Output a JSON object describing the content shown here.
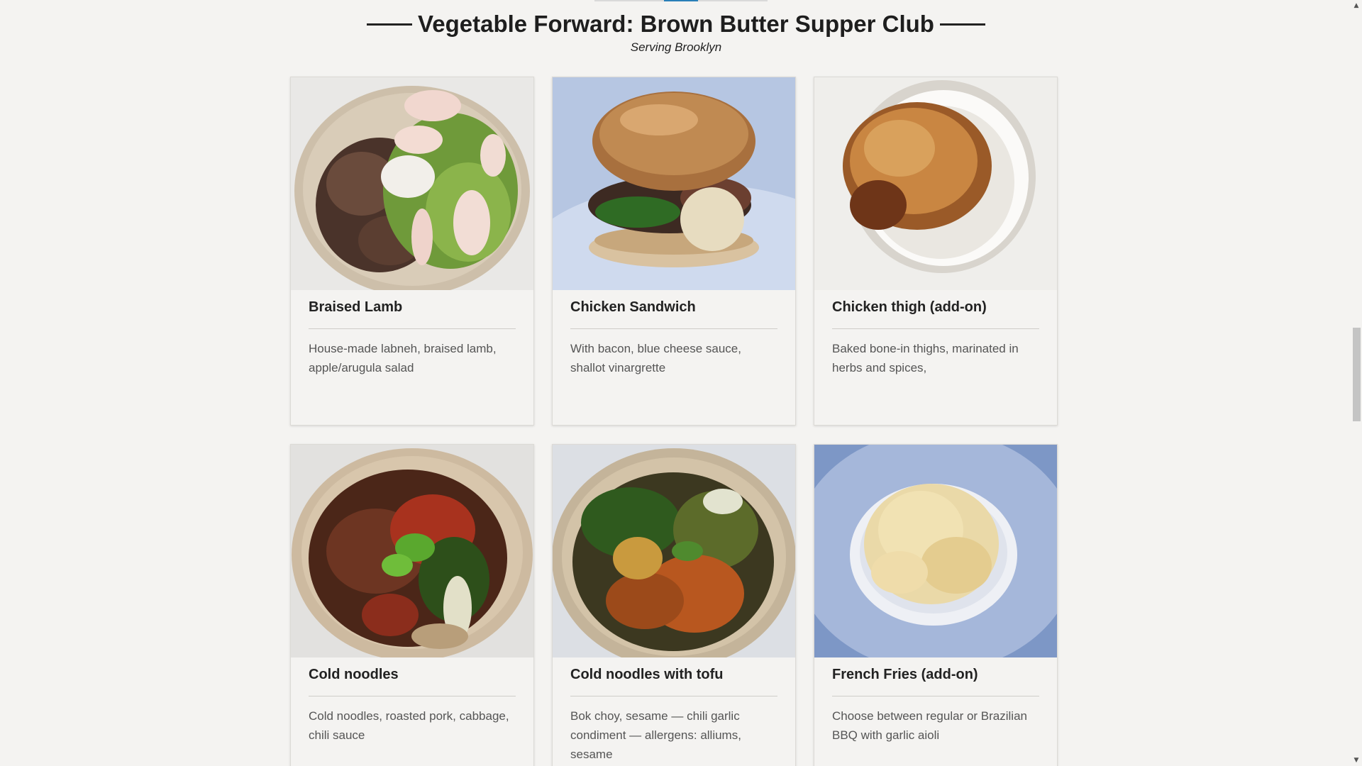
{
  "header": {
    "title": "Vegetable Forward: Brown Butter Supper Club",
    "subtitle": "Serving Brooklyn"
  },
  "menu": {
    "items": [
      {
        "name": "Braised Lamb",
        "description": "House-made labneh, braised lamb, apple/arugula salad",
        "image_icon": "braised-lamb-bowl-photo"
      },
      {
        "name": "Chicken Sandwich",
        "description": "With bacon, blue cheese sauce, shallot vinargrette",
        "image_icon": "chicken-sandwich-photo"
      },
      {
        "name": "Chicken thigh (add-on)",
        "description": "Baked bone-in thighs, marinated in herbs and spices,",
        "image_icon": "chicken-thigh-photo"
      },
      {
        "name": "Cold noodles",
        "description": "Cold noodles, roasted pork, cabbage, chili sauce",
        "image_icon": "cold-noodles-bowl-photo"
      },
      {
        "name": "Cold noodles with tofu",
        "description": "Bok choy, sesame — chili garlic condiment — allergens: alliums, sesame",
        "image_icon": "cold-noodles-tofu-bowl-photo"
      },
      {
        "name": "French Fries (add-on)",
        "description": "Choose between regular or Brazilian BBQ with garlic aioli",
        "image_icon": "french-fries-photo"
      }
    ]
  },
  "colors": {
    "background": "#f4f3f1",
    "active_tab": "#2a7fb8",
    "text": "#222222",
    "muted_text": "#555555"
  }
}
